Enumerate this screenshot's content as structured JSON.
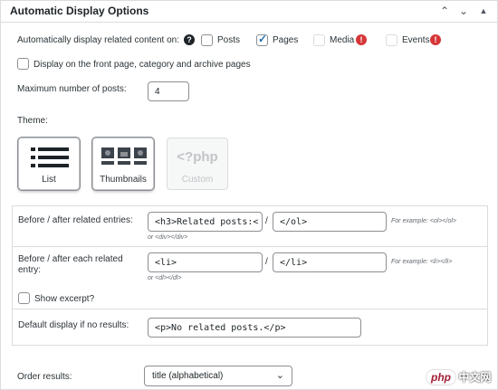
{
  "header": {
    "title": "Automatic Display Options"
  },
  "display_on": {
    "label": "Automatically display related content on:",
    "options": [
      {
        "label": "Posts",
        "checked": false
      },
      {
        "label": "Pages",
        "checked": true
      },
      {
        "label": "Media",
        "disabled": true
      },
      {
        "label": "Events",
        "disabled": true
      }
    ],
    "front_page_label": "Display on the front page, category and archive pages"
  },
  "max_posts": {
    "label": "Maximum number of posts:",
    "value": "4"
  },
  "theme": {
    "label": "Theme:",
    "options": [
      {
        "label": "List",
        "active": true
      },
      {
        "label": "Thumbnails",
        "active": true
      },
      {
        "label": "Custom",
        "disabled": true,
        "glyph": "<?php"
      }
    ]
  },
  "markup": {
    "entries": {
      "label": "Before / after related entries:",
      "before": "<h3>Related posts:<",
      "separator": "/",
      "after": "</ol>",
      "example": "For example: <ol></ol>",
      "alt": "or <div></div>"
    },
    "each_entry": {
      "label": "Before / after each related entry:",
      "before": "<li>",
      "separator": "/",
      "after": "</li>",
      "example": "For example: <li></li>",
      "alt": "or <dl></dl>"
    },
    "show_excerpt_label": "Show excerpt?",
    "no_results": {
      "label": "Default display if no results:",
      "value": "<p>No related posts.</p>"
    }
  },
  "order": {
    "label": "Order results:",
    "value": "title (alphabetical)"
  },
  "watermark": {
    "brand": "php",
    "site": "中文网"
  }
}
